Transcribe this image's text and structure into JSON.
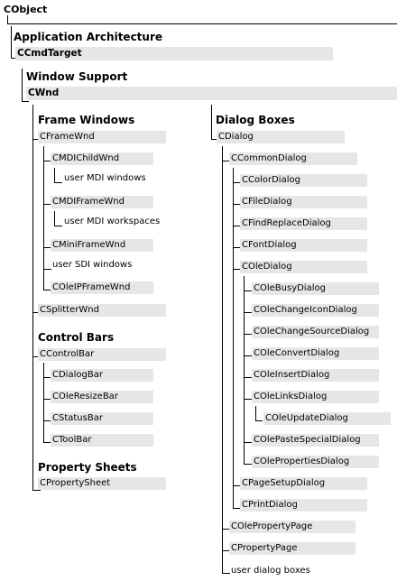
{
  "root": {
    "label": "CObject"
  },
  "architecture": {
    "heading": "Application Architecture",
    "target": "CCmdTarget"
  },
  "window_support": {
    "heading": "Window Support",
    "wnd": "CWnd"
  },
  "frame_windows": {
    "heading": "Frame Windows",
    "frame_wnd": "CFrameWnd",
    "mdi_child": "CMDIChildWnd",
    "user_mdi_windows": "user MDI windows",
    "mdi_frame": "CMDIFrameWnd",
    "user_mdi_workspaces": "user MDI workspaces",
    "mini_frame": "CMiniFrameWnd",
    "user_sdi_windows": "user SDI windows",
    "ole_ip_frame": "COleIPFrameWnd",
    "splitter": "CSplitterWnd"
  },
  "control_bars": {
    "heading": "Control Bars",
    "control_bar": "CControlBar",
    "dialog_bar": "CDialogBar",
    "ole_resize_bar": "COleResizeBar",
    "status_bar": "CStatusBar",
    "tool_bar": "CToolBar"
  },
  "property_sheets": {
    "heading": "Property Sheets",
    "property_sheet": "CPropertySheet"
  },
  "dialog_boxes": {
    "heading": "Dialog Boxes",
    "dialog": "CDialog",
    "common_dialog": "CCommonDialog",
    "color_dialog": "CColorDialog",
    "file_dialog": "CFileDialog",
    "find_replace_dialog": "CFindReplaceDialog",
    "font_dialog": "CFontDialog",
    "ole_dialog": "COleDialog",
    "ole_busy_dialog": "COleBusyDialog",
    "ole_change_icon_dialog": "COleChangeIconDialog",
    "ole_change_source_dialog": "COleChangeSourceDialog",
    "ole_convert_dialog": "COleConvertDialog",
    "ole_insert_dialog": "COleInsertDialog",
    "ole_links_dialog": "COleLinksDialog",
    "ole_update_dialog": "COleUpdateDialog",
    "ole_paste_special_dialog": "COlePasteSpecialDialog",
    "ole_properties_dialog": "COlePropertiesDialog",
    "page_setup_dialog": "CPageSetupDialog",
    "print_dialog": "CPrintDialog",
    "ole_property_page": "COlePropertyPage",
    "property_page": "CPropertyPage",
    "user_dialog_boxes": "user dialog boxes"
  }
}
